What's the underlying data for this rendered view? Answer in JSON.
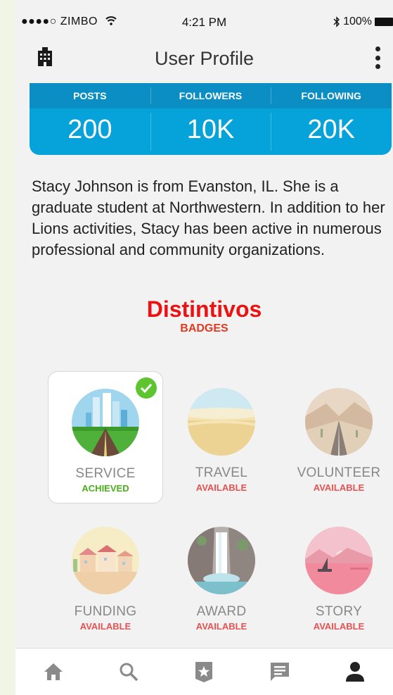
{
  "status_bar": {
    "carrier": "●●●●○ ZIMBO",
    "time": "4:21 PM",
    "battery": "100%"
  },
  "nav": {
    "title": "User Profile"
  },
  "stats": [
    {
      "label": "POSTS",
      "value": "200"
    },
    {
      "label": "FOLLOWERS",
      "value": "10K"
    },
    {
      "label": "FOLLOWING",
      "value": "20K"
    }
  ],
  "bio": "Stacy Johnson is from Evanston, IL. She is a graduate student at Northwestern. In addition to her Lions activities, Stacy has been active in numerous professional and community organizations.",
  "badges_section": {
    "title": "Distintivos",
    "subtitle": "BADGES"
  },
  "badges": [
    {
      "name": "SERVICE",
      "status": "ACHIEVED"
    },
    {
      "name": "TRAVEL",
      "status": "AVAILABLE"
    },
    {
      "name": "VOLUNTEER",
      "status": "AVAILABLE"
    },
    {
      "name": "FUNDING",
      "status": "AVAILABLE"
    },
    {
      "name": "AWARD",
      "status": "AVAILABLE"
    },
    {
      "name": "STORY",
      "status": "AVAILABLE"
    }
  ],
  "tabs": [
    "home-icon",
    "search-icon",
    "badge-star-icon",
    "chat-icon",
    "profile-icon"
  ],
  "colors": {
    "accent": "#06a3db",
    "achieved": "#4caf1a",
    "available": "#e55353",
    "title_red": "#ee1111"
  }
}
